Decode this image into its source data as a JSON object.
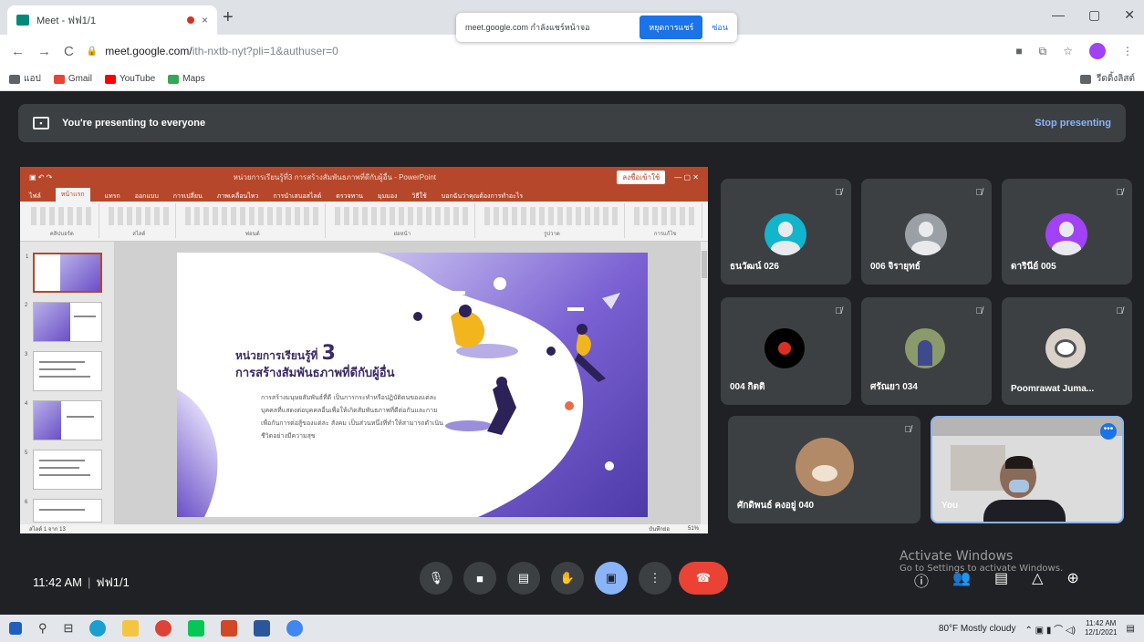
{
  "browser": {
    "tab_title": "Meet - ฟฟ1/1",
    "close_tab": "×",
    "new_tab": "+",
    "url": "meet.google.com/",
    "url_rest": "ith-nxtb-nyt?pli=1&authuser=0",
    "back": "←",
    "forward": "→",
    "reload": "C",
    "lock": "🔒",
    "minimize": "—",
    "maximize": "▢",
    "close": "✕",
    "notice": {
      "message": "meet.google.com กำลังแชร์หน้าจอ",
      "stop_label": "หยุดการแชร์",
      "hide_label": "ซ่อน"
    },
    "bookmarks": {
      "apps": "แอป",
      "gmail": "Gmail",
      "youtube": "YouTube",
      "maps": "Maps",
      "reading_list": "รีดดิ้งลิสต์"
    },
    "colors": {
      "gmail": "#ea4335",
      "youtube": "#ff0000",
      "maps": "#34a853"
    }
  },
  "meet": {
    "presenting_text": "You're presenting to everyone",
    "stop_presenting": "Stop presenting",
    "time": "11:42 AM",
    "meeting_code": "ฟฟ1/1",
    "self_label": "You",
    "participants": [
      {
        "name": "ธนวัฒน์ 026",
        "color": "#12b5cb"
      },
      {
        "name": "006 จิรายุทธ์",
        "color": "#9aa0a6"
      },
      {
        "name": "ดารินีย์ 005",
        "color": "#a142f4"
      },
      {
        "name": "004 กิตติ",
        "color": "#000000"
      },
      {
        "name": "ศรัณยา 034",
        "color": "#8b9a6a"
      },
      {
        "name": "Poomrawat Juma...",
        "color": "#d9d2c8"
      },
      {
        "name": "ศักดิพนธ์ คงอยู่ 040",
        "color": "#b38a68"
      }
    ],
    "accent": "#8ab4f8",
    "end_call_color": "#ea4335"
  },
  "slide": {
    "unit_label": "หน่วยการเรียนรู้ที่",
    "unit_number": "3",
    "topic": "การสร้างสัมพันธภาพที่ดีกับผู้อื่น",
    "body": "การสร้างมนุษยสัมพันธ์ที่ดี เป็นการกระทำหรือปฏิบัติตนของแต่ละบุคคลที่แสดงต่อบุคคลอื่นเพื่อให้เกิดสัมพันธภาพที่ดีต่อกันและกาย เพื่อกันการต่อสู้ของแต่ละ สังคม เป็นส่วนหนึ่งที่ทำให้สามารถดำเนินชีวิตอย่างมีความสุข"
  },
  "powerpoint": {
    "title": "หน่วยการเรียนรู้ที่3 การสร้างสัมพันธภาพที่ดีกับผู้อื่น - PowerPoint",
    "account": "ลงชื่อเข้าใช้",
    "tabs": [
      "ไฟล์",
      "หน้าแรก",
      "แทรก",
      "ออกแบบ",
      "การเปลี่ยน",
      "ภาพเคลื่อนไหว",
      "การนำเสนอสไลด์",
      "ตรวจทาน",
      "มุมมอง",
      "วิธีใช้",
      "บอกฉันว่าคุณต้องการทำอะไร"
    ],
    "ribbon_groups": [
      "คลิปบอร์ด",
      "สไลด์",
      "ฟอนต์",
      "ย่อหน้า",
      "รูปวาด",
      "การแก้ไข"
    ],
    "status": "สไลด์ 1 จาก 13",
    "notes": "บันทึกย่อ",
    "zoom": "51%"
  },
  "taskbar": {
    "weather": "80°F Mostly cloudy",
    "time": "11:42 AM",
    "date": "12/1/2021"
  },
  "windows": {
    "activate_line1": "Activate Windows",
    "activate_line2": "Go to Settings to activate Windows."
  }
}
